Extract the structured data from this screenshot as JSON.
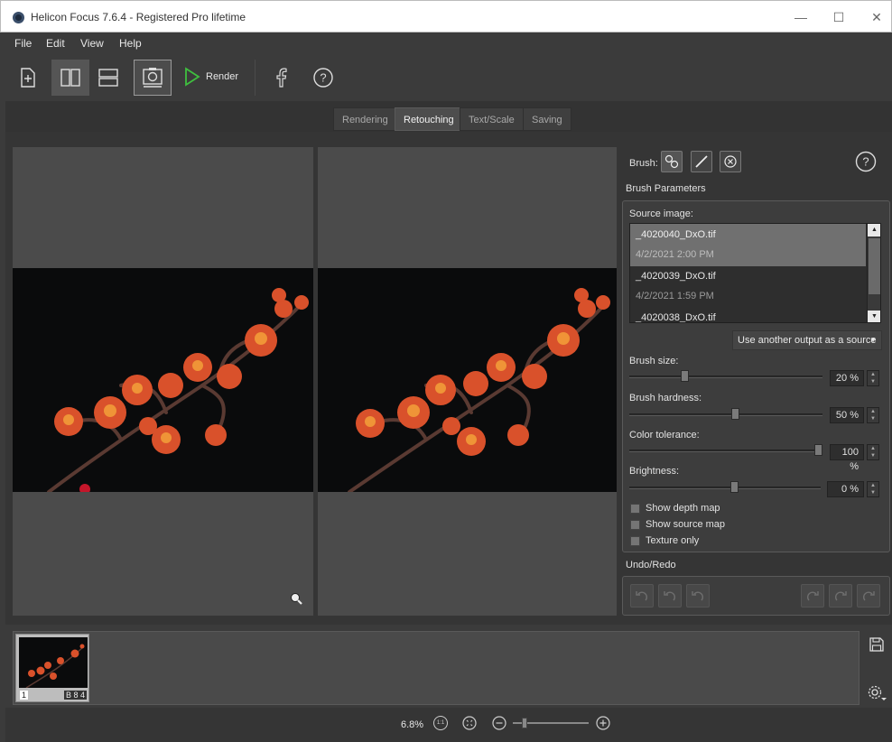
{
  "window": {
    "title": "Helicon Focus 7.6.4 - Registered Pro lifetime",
    "minimize": "—",
    "maximize": "☐",
    "close": "✕"
  },
  "menu": [
    "File",
    "Edit",
    "View",
    "Help"
  ],
  "toolbar": {
    "render_label": "Render",
    "icons": [
      "add-file-icon",
      "split-vertical-icon",
      "split-horizontal-icon",
      "camera-icon",
      "render-play-icon",
      "facebook-icon",
      "help-icon"
    ]
  },
  "tabs": [
    {
      "label": "Rendering",
      "active": false
    },
    {
      "label": "Retouching",
      "active": true
    },
    {
      "label": "Text/Scale",
      "active": false
    },
    {
      "label": "Saving",
      "active": false
    }
  ],
  "panel": {
    "brush_label": "Brush:",
    "brush_params_label": "Brush Parameters",
    "source_image_label": "Source image:",
    "sources": [
      {
        "name": "_4020040_DxO.tif",
        "date": "4/2/2021 2:00 PM",
        "selected": true
      },
      {
        "name": "_4020039_DxO.tif",
        "date": "4/2/2021 1:59 PM",
        "selected": false
      },
      {
        "name": "_4020038_DxO.tif",
        "date": "",
        "selected": false
      }
    ],
    "use_another_output": "Use another output as a source",
    "brush_size_label": "Brush size:",
    "brush_size_value": "20 %",
    "brush_size_fraction": 0.2,
    "brush_hardness_label": "Brush hardness:",
    "brush_hardness_value": "50 %",
    "brush_hardness_fraction": 0.5,
    "color_tolerance_label": "Color tolerance:",
    "color_tolerance_value": "100 %",
    "color_tolerance_fraction": 1.0,
    "brightness_label": "Brightness:",
    "brightness_value": "0 %",
    "brightness_fraction": 0.5,
    "checkboxes": [
      "Show depth map",
      "Show source map",
      "Texture only"
    ],
    "undo_redo_label": "Undo/Redo"
  },
  "filmstrip": {
    "thumb_left": "1",
    "thumb_right": "B 8 4"
  },
  "status": {
    "zoom": "6.8%",
    "fit_label": "1:1"
  },
  "colors": {
    "accent_green": "#3fbf3f",
    "background": "#3b3b3b",
    "panel": "#3d3d3d"
  }
}
